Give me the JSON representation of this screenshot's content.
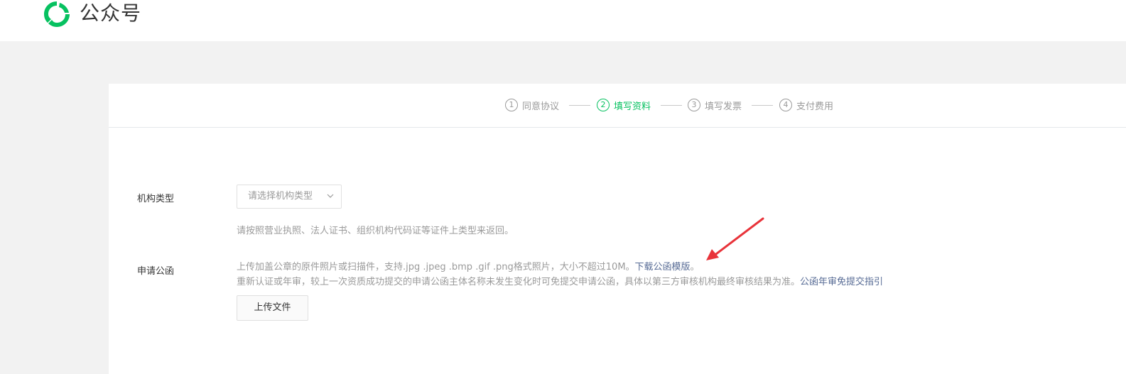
{
  "header": {
    "brand": "公众号",
    "logo_icon": "wechat-official-logo-icon"
  },
  "colors": {
    "accent": "#07c160",
    "link": "#576b95",
    "muted": "#9a9a9a",
    "annotation_arrow": "#e8333a"
  },
  "steps": [
    {
      "num": "1",
      "label": "同意协议",
      "active": false
    },
    {
      "num": "2",
      "label": "填写资料",
      "active": true
    },
    {
      "num": "3",
      "label": "填写发票",
      "active": false
    },
    {
      "num": "4",
      "label": "支付费用",
      "active": false
    }
  ],
  "form": {
    "org_type": {
      "label": "机构类型",
      "select_placeholder": "请选择机构类型",
      "hint": "请按照营业执照、法人证书、组织机构代码证等证件上类型来返回。"
    },
    "letter": {
      "label": "申请公函",
      "hint_line1": "上传加盖公章的原件照片或扫描件，支持.jpg .jpeg .bmp .gif .png格式照片，大小不超过10M。",
      "download_link": "下载公函模版",
      "hint_line1_end": "。",
      "hint_line2": "重新认证或年审，较上一次资质成功提交的申请公函主体名称未发生变化时可免提交申请公函，具体以第三方审核机构最终审核结果为准。",
      "guide_link": "公函年审免提交指引",
      "upload_button": "上传文件"
    }
  }
}
